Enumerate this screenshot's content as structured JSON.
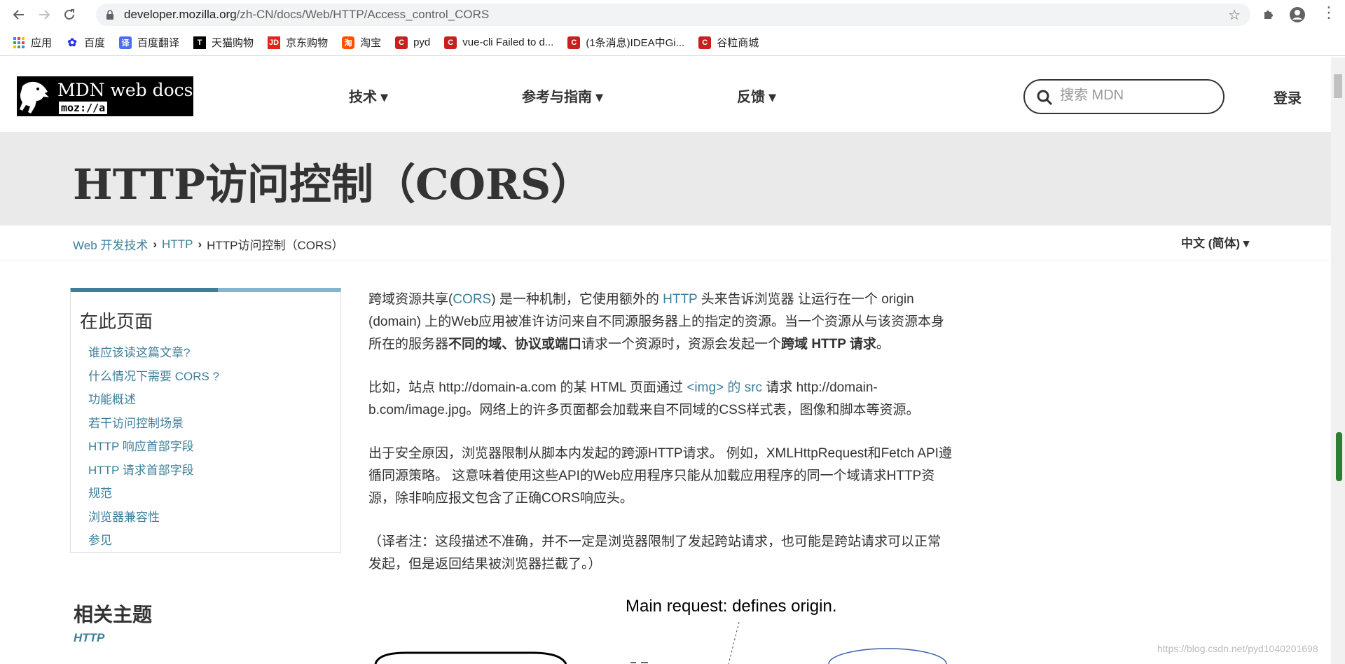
{
  "browser": {
    "url_host": "developer.mozilla.org",
    "url_path": "/zh-CN/docs/Web/HTTP/Access_control_CORS"
  },
  "bookmarks": [
    {
      "label": "应用",
      "icon": "apps-grid-icon",
      "color": "#4285f4"
    },
    {
      "label": "百度",
      "icon": "baidu-paw-icon",
      "color": "#2932e1"
    },
    {
      "label": "百度翻译",
      "icon": "baidu-translate-icon",
      "color": "#4e6ef2"
    },
    {
      "label": "天猫购物",
      "icon": "tmall-icon",
      "color": "#000000"
    },
    {
      "label": "京东购物",
      "icon": "jd-icon",
      "color": "#e1251b"
    },
    {
      "label": "淘宝",
      "icon": "taobao-icon",
      "color": "#ff5000"
    },
    {
      "label": "pyd",
      "icon": "csdn-icon",
      "color": "#c7211f"
    },
    {
      "label": "vue-cli Failed to d...",
      "icon": "csdn-icon",
      "color": "#c7211f"
    },
    {
      "label": "(1条消息)IDEA中Gi...",
      "icon": "csdn-icon",
      "color": "#c7211f"
    },
    {
      "label": "谷粒商城",
      "icon": "csdn-icon",
      "color": "#c7211f"
    }
  ],
  "header": {
    "logo_title": "MDN web docs",
    "logo_sub": "moz://a",
    "nav": [
      "技术 ▾",
      "参考与指南 ▾",
      "反馈 ▾"
    ],
    "search_placeholder": "搜索 MDN",
    "login": "登录"
  },
  "page": {
    "title": "HTTP访问控制（CORS）",
    "breadcrumb": [
      "Web 开发技术",
      "HTTP",
      "HTTP访问控制（CORS）"
    ],
    "language": "中文 (简体) ▾"
  },
  "toc": {
    "title": "在此页面",
    "items": [
      "谁应该读这篇文章?",
      "什么情况下需要 CORS ?",
      "功能概述",
      "若干访问控制场景",
      "HTTP 响应首部字段",
      "HTTP 请求首部字段",
      "规范",
      "浏览器兼容性",
      "参见"
    ]
  },
  "related": {
    "title": "相关主题",
    "link": "HTTP"
  },
  "article": {
    "p1_a": "跨域资源共享(",
    "p1_link1": "CORS",
    "p1_b": ") 是一种机制，它使用额外的 ",
    "p1_link2": "HTTP",
    "p1_c": " 头来告诉浏览器  让运行在一个 origin (domain) 上的Web应用被准许访问来自不同源服务器上的指定的资源。当一个资源从与该资源本身所在的服务器",
    "p1_bold1": "不同的域、协议或端口",
    "p1_d": "请求一个资源时，资源会发起一个",
    "p1_bold2": "跨域 HTTP 请求",
    "p1_e": "。",
    "p2_a": "比如，站点 http://domain-a.com 的某 HTML 页面通过 ",
    "p2_link": "<img> 的 src",
    "p2_b": " 请求 http://domain-b.com/image.jpg。网络上的许多页面都会加载来自不同域的CSS样式表，图像和脚本等资源。",
    "p3": "出于安全原因，浏览器限制从脚本内发起的跨源HTTP请求。 例如，XMLHttpRequest和Fetch API遵循同源策略。 这意味着使用这些API的Web应用程序只能从加载应用程序的同一个域请求HTTP资源，除非响应报文包含了正确CORS响应头。",
    "p4": "（译者注：这段描述不准确，并不一定是浏览器限制了发起跨站请求，也可能是跨站请求可以正常发起，但是返回结果被浏览器拦截了。）"
  },
  "diagram": {
    "caption": "Main request: defines origin."
  },
  "watermark": "https://blog.csdn.net/pyd1040201698"
}
